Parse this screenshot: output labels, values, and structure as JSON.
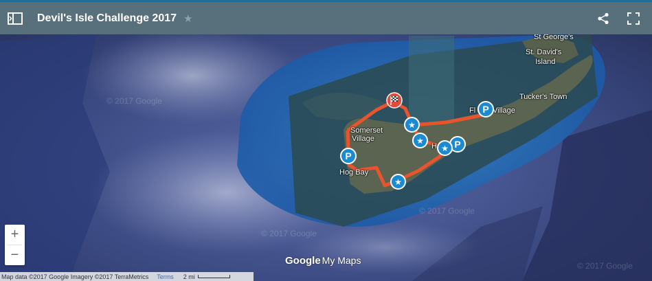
{
  "header": {
    "title": "Devil's Isle Challenge 2017"
  },
  "map": {
    "labels": [
      {
        "id": "st-georges",
        "text": "St George's"
      },
      {
        "id": "st-davids",
        "text": "St. David's"
      },
      {
        "id": "island",
        "text": "Island"
      },
      {
        "id": "tuckers-town",
        "text": "Tucker's Town"
      },
      {
        "id": "flatts",
        "text": "Fl"
      },
      {
        "id": "flatts-village",
        "text": "Village"
      },
      {
        "id": "somerset",
        "text": "Somerset"
      },
      {
        "id": "somerset-village",
        "text": "Village"
      },
      {
        "id": "hog-bay",
        "text": "Hog Bay"
      },
      {
        "id": "ha",
        "text": "Ha"
      }
    ],
    "watermark": "© 2017 Google",
    "marker_parking_glyph": "P",
    "marker_star_glyph": "★"
  },
  "controls": {
    "zoom_in": "+",
    "zoom_out": "−"
  },
  "footer": {
    "map_data": "Map data ©2017 Google Imagery ©2017 TerraMetrics",
    "terms": "Terms",
    "scale": "2 mi"
  },
  "branding": {
    "google": "Google",
    "mymaps": "My Maps"
  }
}
